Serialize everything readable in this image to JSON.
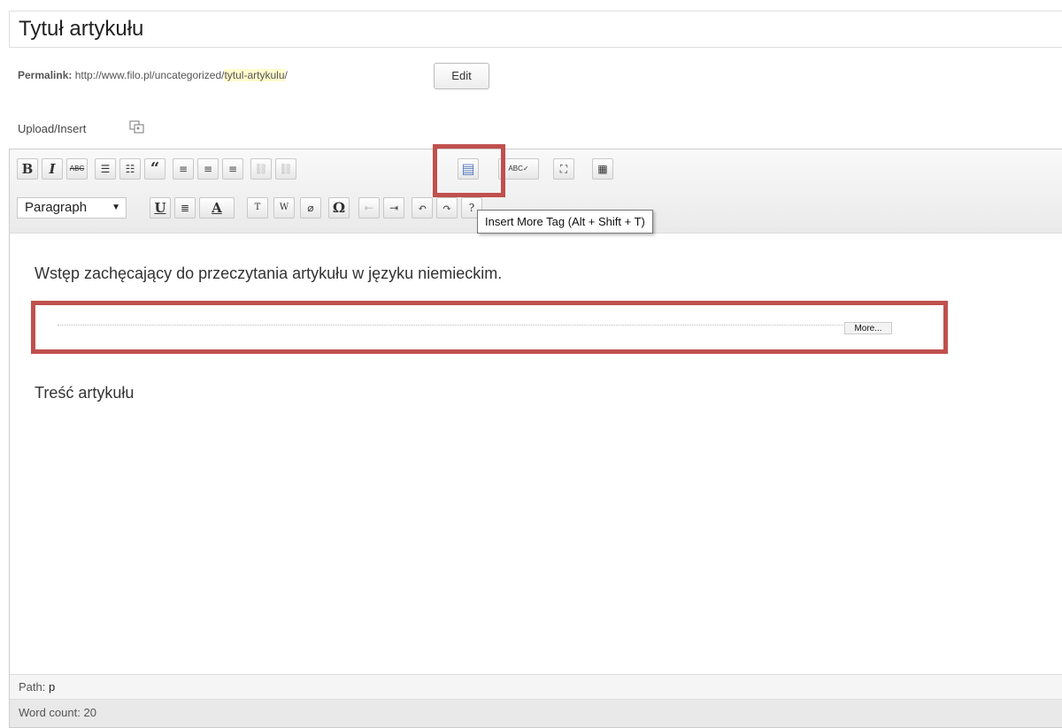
{
  "title": {
    "value": "Tytuł artykułu"
  },
  "permalink": {
    "label": "Permalink:",
    "base": "http://www.filo.pl/uncategorized/",
    "slug": "tytul-artykulu",
    "suffix": "/",
    "edit_label": "Edit"
  },
  "upload": {
    "label": "Upload/Insert"
  },
  "toolbar": {
    "row1": [
      {
        "name": "bold-button",
        "glyph": "B"
      },
      {
        "name": "italic-button",
        "glyph": "I"
      },
      {
        "name": "strikethrough-button",
        "glyph": "ABC"
      },
      {
        "name": "bullet-list-button",
        "glyph": "☰"
      },
      {
        "name": "numbered-list-button",
        "glyph": "☷"
      },
      {
        "name": "blockquote-button",
        "glyph": "“"
      },
      {
        "name": "align-left-button",
        "glyph": "≡"
      },
      {
        "name": "align-center-button",
        "glyph": "≡"
      },
      {
        "name": "align-right-button",
        "glyph": "≡"
      },
      {
        "name": "insert-link-button",
        "glyph": "⛓"
      },
      {
        "name": "remove-link-button",
        "glyph": "⛓"
      },
      {
        "name": "insert-more-button",
        "glyph": "▤"
      },
      {
        "name": "spellcheck-button",
        "glyph": "ABC✓"
      },
      {
        "name": "fullscreen-button",
        "glyph": "⛶"
      },
      {
        "name": "kitchen-sink-button",
        "glyph": "▦"
      }
    ],
    "row2": [
      {
        "name": "underline-button",
        "glyph": "U"
      },
      {
        "name": "justify-button",
        "glyph": "≣"
      },
      {
        "name": "text-color-button",
        "glyph": "A"
      },
      {
        "name": "paste-text-button",
        "glyph": "T"
      },
      {
        "name": "paste-word-button",
        "glyph": "W"
      },
      {
        "name": "remove-format-button",
        "glyph": "⌀"
      },
      {
        "name": "special-char-button",
        "glyph": "Ω"
      },
      {
        "name": "outdent-button",
        "glyph": "⇤"
      },
      {
        "name": "indent-button",
        "glyph": "⇥"
      },
      {
        "name": "undo-button",
        "glyph": "↶"
      },
      {
        "name": "redo-button",
        "glyph": "↷"
      },
      {
        "name": "help-button",
        "glyph": "?"
      }
    ],
    "format_select": "Paragraph",
    "tooltip": "Insert More Tag (Alt + Shift + T)"
  },
  "content": {
    "intro": "Wstęp zachęcający do przeczytania artykułu w języku niemieckim.",
    "more_label": "More...",
    "body": "Treść artykułu"
  },
  "status": {
    "path_label": "Path:",
    "path_value": "p",
    "word_count": "Word count: 20"
  }
}
